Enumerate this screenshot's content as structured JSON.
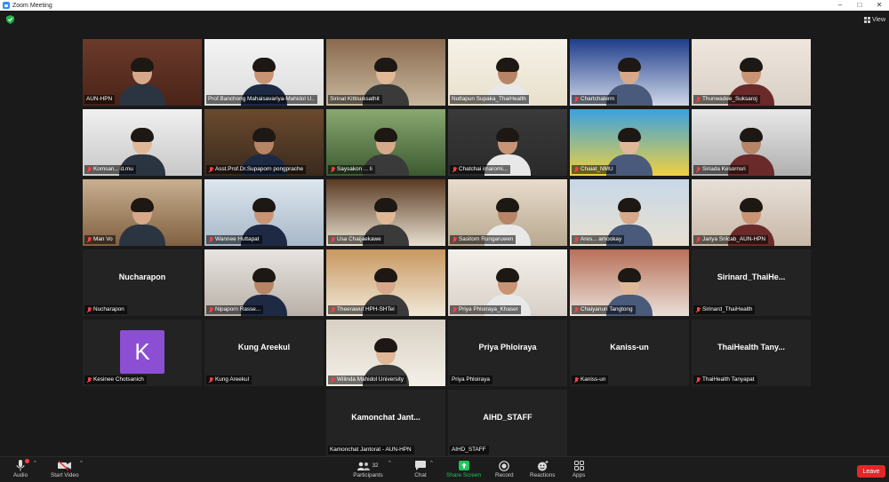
{
  "window": {
    "title": "Zoom Meeting",
    "minimize": "–",
    "maximize": "□",
    "close": "✕"
  },
  "topbar": {
    "view_label": "View",
    "security_icon": "shield-check-icon"
  },
  "accent_active": "#e8d33a",
  "participants": [
    {
      "name": "AUN-HPN",
      "muted": false
    },
    {
      "name": "Prof.Banchong Mahaisavariya-Mahidol U..",
      "muted": false
    },
    {
      "name": "Sirinat Kittisuksathit",
      "muted": false
    },
    {
      "name": "Nuttapun Supaka_ThaiHealth",
      "muted": false
    },
    {
      "name": "Chartchalerm",
      "muted": true
    },
    {
      "name": "Thunwadee_Suksaroj",
      "muted": true
    },
    {
      "name": "Komsan... d.mu",
      "muted": true
    },
    {
      "name": "Asst.Prof.Dr.Supaporn pongprache",
      "muted": true
    },
    {
      "name": "Saysakon ... li",
      "muted": true
    },
    {
      "name": "Chatchai imaromi...",
      "muted": true
    },
    {
      "name": "Chaiat_NMU",
      "muted": true
    },
    {
      "name": "Siriada Kesornsri",
      "muted": true
    },
    {
      "name": "Man Vo",
      "muted": true
    },
    {
      "name": "Wannee Huttapat",
      "muted": true
    },
    {
      "name": "Usa Chaijaekawe",
      "muted": true
    },
    {
      "name": "Sasitorn Rungaruwen",
      "muted": true
    },
    {
      "name": "Ares... amookay",
      "muted": true
    },
    {
      "name": "Jariya Srilcab_AUN-HPN",
      "muted": true
    },
    {
      "name": "Nucharapon",
      "display": "Nucharapon",
      "muted": true
    },
    {
      "name": "Nipaporn Rasse...",
      "muted": true
    },
    {
      "name": "Theerawut HPH-SHTel",
      "muted": true
    },
    {
      "name": "Priya Phloiraya_Khaser",
      "muted": true
    },
    {
      "name": "Chaiyanun Tangtong",
      "muted": true
    },
    {
      "name": "Sirinard_ThaiHealth",
      "display": "Sirinard_ThaiHe...",
      "muted": true
    },
    {
      "name": "Kesinee Chotsanich",
      "avatar": "K",
      "muted": true
    },
    {
      "name": "Kung Areekul",
      "display": "Kung Areekul",
      "muted": true
    },
    {
      "name": "Wilinda Mahidol University",
      "muted": true
    },
    {
      "name": "Priya Phloiraya",
      "display": "Priya Phloiraya",
      "muted": false
    },
    {
      "name": "Kaniss-un",
      "display": "Kaniss-un",
      "muted": true
    },
    {
      "name": "ThaiHealth Tanyapat",
      "display": "ThaiHealth Tany...",
      "muted": true
    },
    {
      "name": "Kamonchat Jantorat - AUN-HPN",
      "display": "Kamonchat Jant...",
      "muted": false
    },
    {
      "name": "AIHD_STAFF",
      "display": "AIHD_STAFF",
      "muted": false
    }
  ],
  "toolbar": {
    "audio": "Audio",
    "start_video": "Start Video",
    "participants": "Participants",
    "participant_count": "32",
    "chat": "Chat",
    "share_screen": "Share Screen",
    "record": "Record",
    "reactions": "Reactions",
    "apps": "Apps",
    "leave": "Leave",
    "share_color": "#21c45a"
  }
}
